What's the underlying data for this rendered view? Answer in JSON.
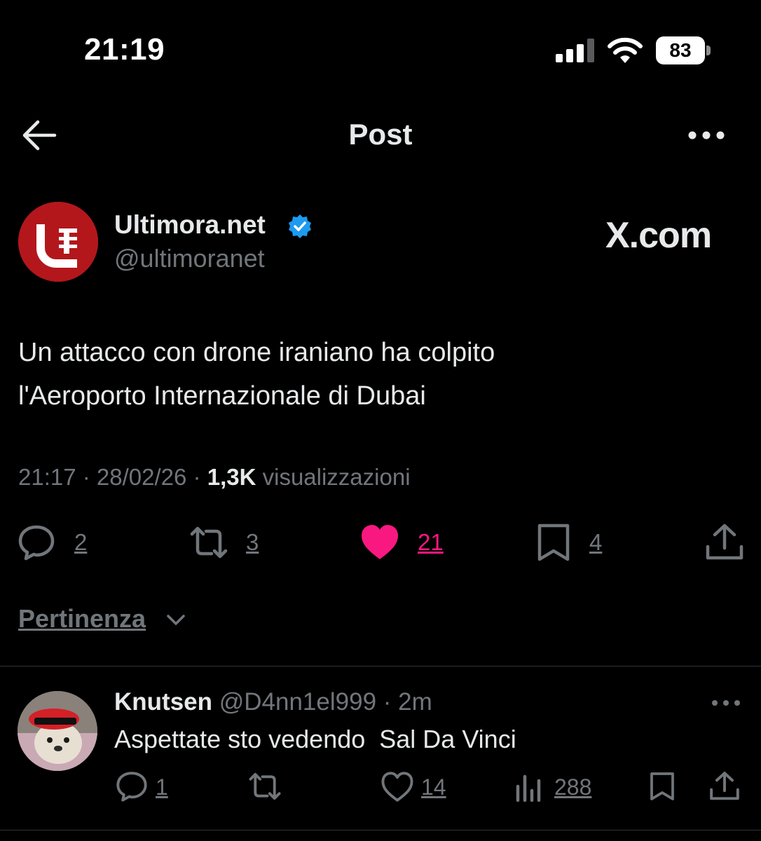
{
  "status_bar": {
    "time": "21:19",
    "battery": "83"
  },
  "header": {
    "title": "Post"
  },
  "post": {
    "author_name": "Ultimora.net",
    "handle": "@ultimoranet",
    "watermark": "X.com",
    "text_line1": "Un attacco con drone iraniano ha colpito",
    "text_line2": "l'Aeroporto Internazionale di Dubai",
    "time": "21:17",
    "date": "28/02/26",
    "views_count": "1,3K",
    "views_label": "visualizzazioni",
    "replies": "2",
    "reposts": "3",
    "likes": "21",
    "bookmarks": "4"
  },
  "sort": {
    "label": "Pertinenza"
  },
  "reply": {
    "name": "Knutsen",
    "handle": "@D4nn1el999",
    "age": "2m",
    "text": "Aspettate sto vedendo  Sal Da Vinci",
    "replies": "1",
    "likes": "14",
    "views": "288"
  },
  "colors": {
    "background": "#000000",
    "text": "#e7e9ea",
    "secondary": "#71767b",
    "like_pink": "#f91880",
    "verified_blue": "#1d9bf0",
    "brand_red": "#b3171c"
  },
  "icons": [
    "signal-icon",
    "wifi-icon",
    "battery-icon",
    "back-arrow-icon",
    "more-icon",
    "verified-icon",
    "reply-icon",
    "repost-icon",
    "like-icon",
    "bookmark-icon",
    "share-icon",
    "chevron-down-icon",
    "views-icon"
  ]
}
